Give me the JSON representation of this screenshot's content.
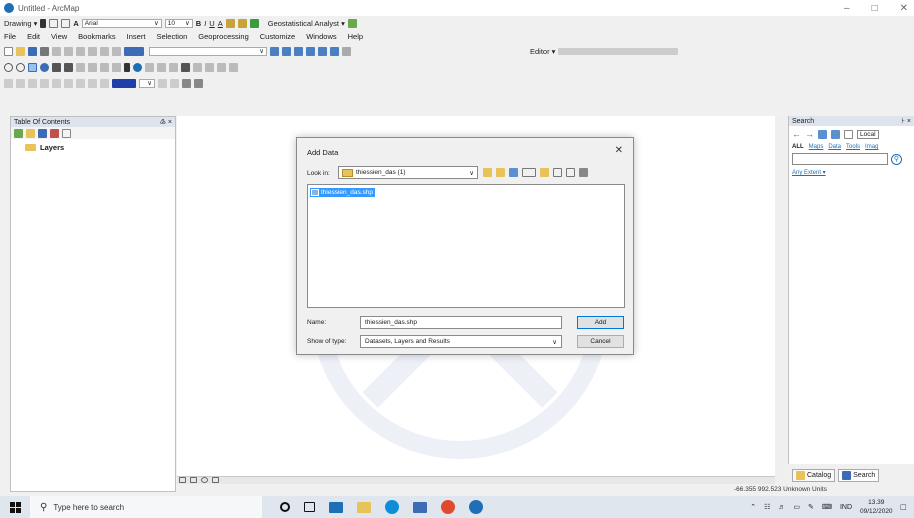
{
  "window": {
    "title": "Untitled - ArcMap"
  },
  "toolbar": {
    "drawing_label": "Drawing ▾",
    "font_name": "Arial",
    "font_size": "10",
    "bold": "B",
    "italic": "I",
    "underline": "U",
    "font_color": "A",
    "geostat_label": "Geostatistical Analyst ▾",
    "editor_label": "Editor ▾"
  },
  "menu": [
    "File",
    "Edit",
    "View",
    "Bookmarks",
    "Insert",
    "Selection",
    "Geoprocessing",
    "Customize",
    "Windows",
    "Help"
  ],
  "toc": {
    "title": "Table Of Contents",
    "pin": "♴ ×",
    "layers_label": "Layers"
  },
  "search_panel": {
    "title": "Search",
    "local_label": "Local",
    "filters": [
      "ALL",
      "Maps",
      "Data",
      "Tools",
      "Imag"
    ],
    "any_extent": "Any Extent ▾"
  },
  "dialog": {
    "title": "Add Data",
    "look_in_label": "Look in:",
    "look_in_value": "thiessien_das (1)",
    "files": [
      "thiessien_das.shp"
    ],
    "name_label": "Name:",
    "name_value": "thiessien_das.shp",
    "type_label": "Show of type:",
    "type_value": "Datasets, Layers and Results",
    "add_label": "Add",
    "cancel_label": "Cancel"
  },
  "bottom_tabs": {
    "catalog": "Catalog",
    "search": "Search"
  },
  "status": {
    "coords": "-66.355  992.523 Unknown Units"
  },
  "taskbar": {
    "search_placeholder": "Type here to search",
    "lang": "IND",
    "time": "13.39",
    "date": "09/12/2020"
  }
}
